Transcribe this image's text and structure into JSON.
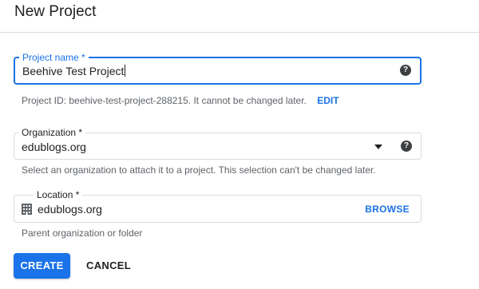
{
  "header": {
    "title": "New Project"
  },
  "project_name": {
    "label": "Project name *",
    "value": "Beehive Test Project",
    "help_icon": "help-icon"
  },
  "project_id": {
    "text": "Project ID: beehive-test-project-288215. It cannot be changed later.",
    "edit_label": "EDIT"
  },
  "organization": {
    "label": "Organization *",
    "value": "edublogs.org",
    "dropdown_icon": "dropdown-icon",
    "help_icon": "help-icon",
    "helper": "Select an organization to attach it to a project. This selection can't be changed later."
  },
  "location": {
    "label": "Location *",
    "value": "edublogs.org",
    "icon": "building-icon",
    "browse_label": "BROWSE",
    "helper": "Parent organization or folder"
  },
  "actions": {
    "create_label": "CREATE",
    "cancel_label": "CANCEL"
  },
  "colors": {
    "accent": "#1a73e8",
    "text": "#202124",
    "muted": "#5f6368",
    "border": "#dadce0"
  }
}
